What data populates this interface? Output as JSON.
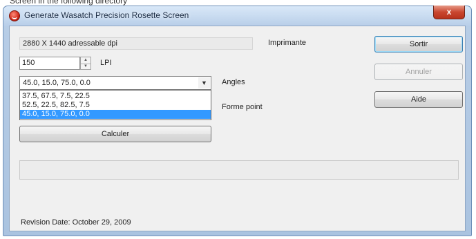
{
  "header_strip": "Screen in the following directory",
  "window": {
    "title": "Generate Wasatch Precision Rosette Screen",
    "close_glyph": "x"
  },
  "resolution_box": {
    "value": "2880 X 1440 adressable dpi"
  },
  "labels": {
    "imprimante": "Imprimante",
    "lpi": "LPI",
    "angles": "Angles",
    "forme_point": "Forme point",
    "revision": "Revision Date: October 29, 2009"
  },
  "lpi_input": {
    "value": "150"
  },
  "angles_combo": {
    "selected": "45.0, 15.0, 75.0, 0.0",
    "options": [
      "37.5, 67.5, 7.5, 22.5",
      "52.5, 22.5, 82.5, 7.5",
      "45.0, 15.0, 75.0, 0.0"
    ],
    "highlighted_index": 2
  },
  "buttons": {
    "calculer": "Calculer",
    "sortir": "Sortir",
    "annuler": "Annuler",
    "aide": "Aide"
  },
  "status": {
    "text": ""
  },
  "colors": {
    "title_bar": "#b9cfe9",
    "close_button": "#c9462f",
    "highlight": "#3399ff"
  },
  "icons": {
    "app": "wasatch-logo-icon",
    "spin": "spin-arrows-icon",
    "dropdown": "chevron-down-icon"
  }
}
